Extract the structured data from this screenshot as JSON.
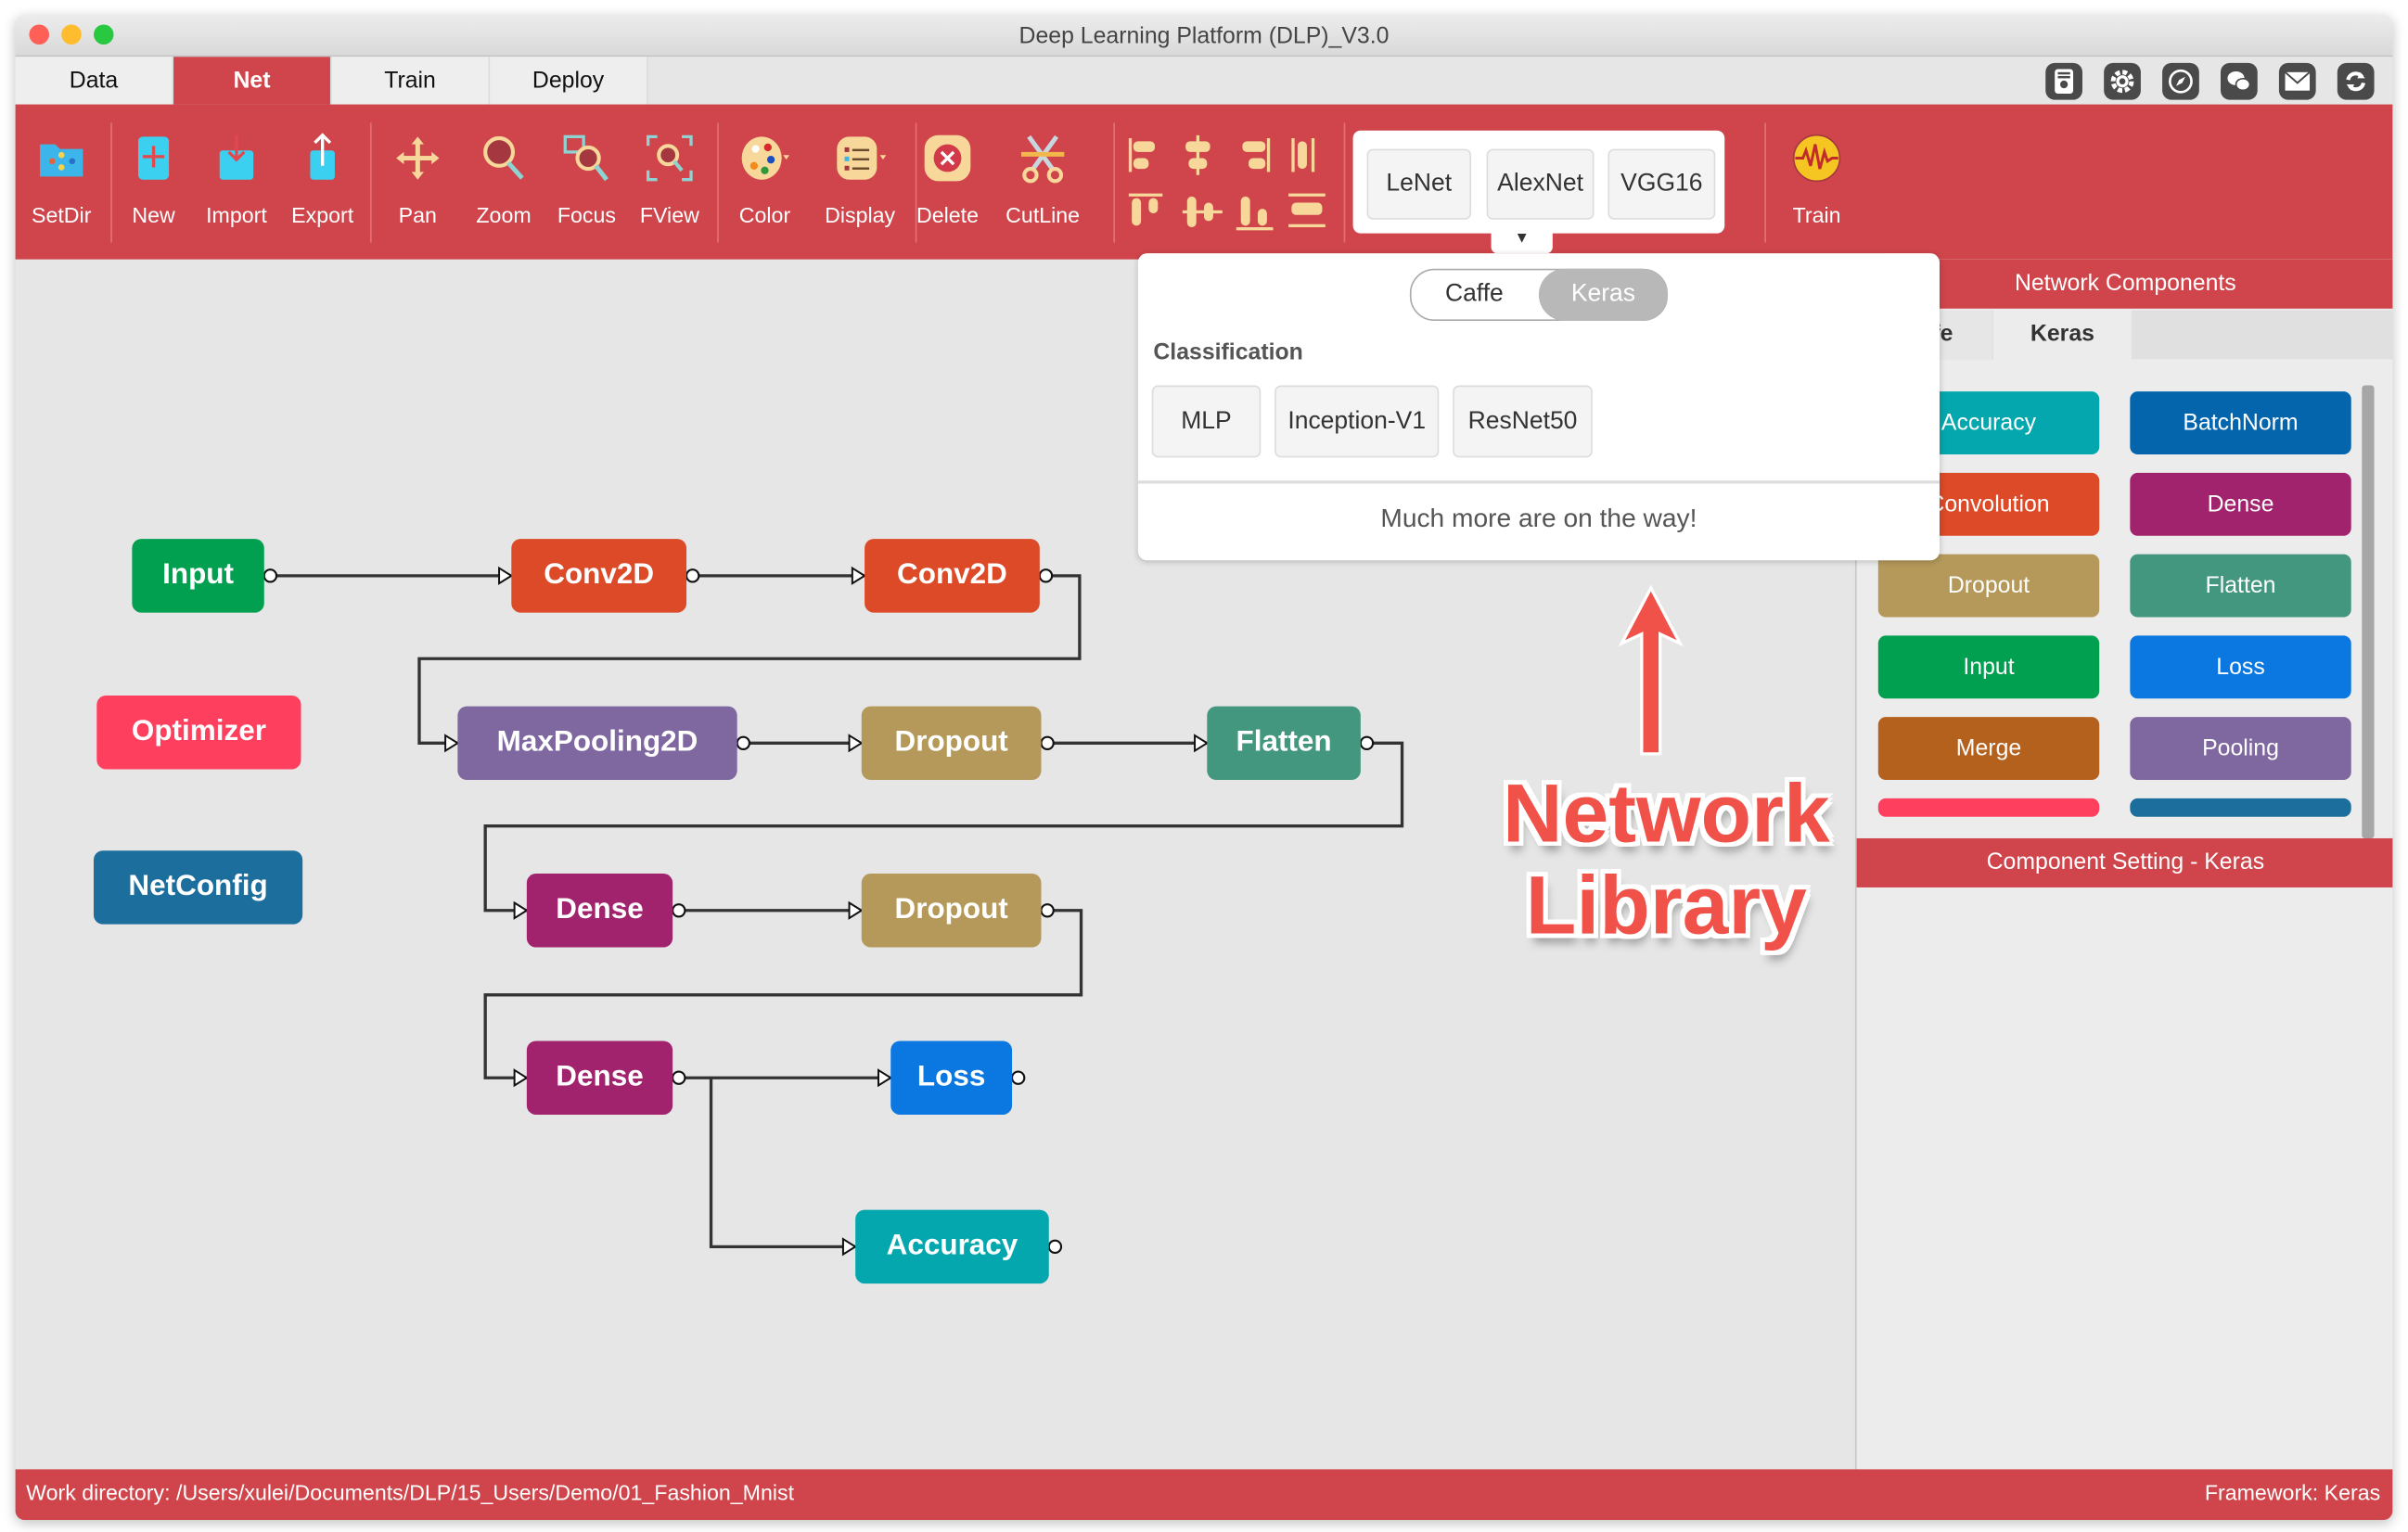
{
  "window": {
    "title": "Deep Learning Platform (DLP)_V3.0",
    "traffic_lights": {
      "close": "#fe5f57",
      "minimize": "#febc2e",
      "zoom": "#28c840"
    }
  },
  "tabs": [
    {
      "label": "Data",
      "active": false
    },
    {
      "label": "Net",
      "active": true
    },
    {
      "label": "Train",
      "active": false
    },
    {
      "label": "Deploy",
      "active": false
    }
  ],
  "top_icons": [
    "certificate-icon",
    "settings-gear-icon",
    "compass-icon",
    "wechat-icon",
    "mail-icon",
    "refresh-icon"
  ],
  "toolbar": {
    "buttons": [
      {
        "id": "setdir",
        "label": "SetDir",
        "icon": "folder-network-icon"
      },
      {
        "id": "new",
        "label": "New",
        "icon": "new-file-icon"
      },
      {
        "id": "import",
        "label": "Import",
        "icon": "import-icon"
      },
      {
        "id": "export",
        "label": "Export",
        "icon": "export-icon"
      },
      {
        "id": "pan",
        "label": "Pan",
        "icon": "pan-arrows-icon"
      },
      {
        "id": "zoom",
        "label": "Zoom",
        "icon": "zoom-magnifier-icon"
      },
      {
        "id": "focus",
        "label": "Focus",
        "icon": "focus-icon"
      },
      {
        "id": "fview",
        "label": "FView",
        "icon": "fit-view-icon"
      },
      {
        "id": "color",
        "label": "Color",
        "icon": "palette-icon"
      },
      {
        "id": "display",
        "label": "Display",
        "icon": "display-list-icon"
      },
      {
        "id": "delete",
        "label": "Delete",
        "icon": "delete-icon"
      },
      {
        "id": "cutline",
        "label": "CutLine",
        "icon": "scissors-icon"
      },
      {
        "id": "train",
        "label": "Train",
        "icon": "waveform-icon"
      }
    ],
    "align_icons": [
      "align-left-icon",
      "align-center-h-icon",
      "align-right-icon",
      "distribute-h-icon",
      "align-top-icon",
      "align-middle-v-icon",
      "align-bottom-icon",
      "distribute-v-icon"
    ],
    "network_library": [
      "LeNet",
      "AlexNet",
      "VGG16"
    ],
    "accent": "#cf454b"
  },
  "popup": {
    "segments": [
      "Caffe",
      "Keras"
    ],
    "selected_segment": "Keras",
    "section_title": "Classification",
    "models": [
      "MLP",
      "Inception-V1",
      "ResNet50"
    ],
    "footer": "Much more are on the way!"
  },
  "canvas": {
    "nodes": [
      {
        "label": "Input",
        "color": "#00a050"
      },
      {
        "label": "Conv2D",
        "color": "#dc4a27"
      },
      {
        "label": "Conv2D",
        "color": "#dc4a27"
      },
      {
        "label": "Optimizer",
        "color": "#fe3f5e"
      },
      {
        "label": "MaxPooling2D",
        "color": "#7f67a0"
      },
      {
        "label": "Dropout",
        "color": "#b4995a"
      },
      {
        "label": "Flatten",
        "color": "#44977f"
      },
      {
        "label": "NetConfig",
        "color": "#1c6e9c"
      },
      {
        "label": "Dense",
        "color": "#a1236d"
      },
      {
        "label": "Dropout",
        "color": "#b4995a"
      },
      {
        "label": "Dense",
        "color": "#a1236d"
      },
      {
        "label": "Loss",
        "color": "#0a78e0"
      },
      {
        "label": "Accuracy",
        "color": "#04a7ad"
      }
    ],
    "annotation": {
      "line1": "Network",
      "line2": "Library"
    }
  },
  "right_panel": {
    "header": "Network Components",
    "tabs": [
      "Caffe",
      "Keras"
    ],
    "active_tab": "Keras",
    "components": [
      {
        "label": "Accuracy",
        "color": "#04a7ad"
      },
      {
        "label": "BatchNorm",
        "color": "#0465ad"
      },
      {
        "label": "Convolution",
        "color": "#dc4a27"
      },
      {
        "label": "Dense",
        "color": "#a1236d"
      },
      {
        "label": "Dropout",
        "color": "#b4995a"
      },
      {
        "label": "Flatten",
        "color": "#44977f"
      },
      {
        "label": "Input",
        "color": "#00a050"
      },
      {
        "label": "Loss",
        "color": "#0a78e0"
      },
      {
        "label": "Merge",
        "color": "#b5611e"
      },
      {
        "label": "Pooling",
        "color": "#7f67a0"
      },
      {
        "label": "",
        "color": "#fe3f5e"
      },
      {
        "label": "",
        "color": "#1c6e9c"
      }
    ],
    "setting_header": "Component Setting - Keras"
  },
  "status": {
    "work_directory": "Work directory: /Users/xulei/Documents/DLP/15_Users/Demo/01_Fashion_Mnist",
    "framework": "Framework: Keras"
  }
}
